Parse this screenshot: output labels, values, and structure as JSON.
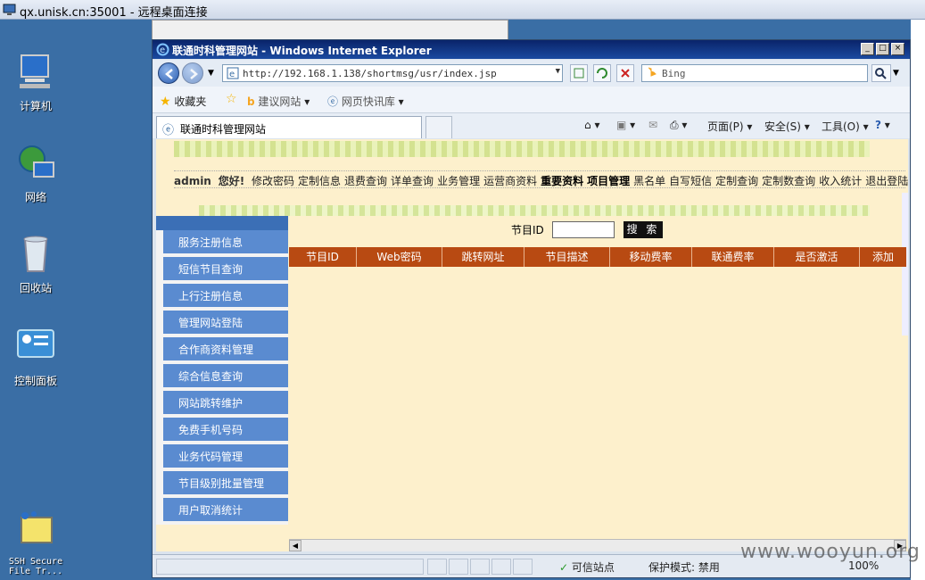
{
  "rdp": {
    "title": "qx.unisk.cn:35001 - 远程桌面连接"
  },
  "desktop": {
    "icons": [
      {
        "label": "计算机",
        "icon": "computer-icon"
      },
      {
        "label": "网络",
        "icon": "network-icon"
      },
      {
        "label": "回收站",
        "icon": "recycle-bin-icon"
      },
      {
        "label": "控制面板",
        "icon": "control-panel-icon"
      },
      {
        "label": "SSH Secure File Tr...",
        "icon": "ssh-file-transfer-icon"
      }
    ]
  },
  "ie": {
    "title": "联通时科管理网站 - Windows Internet Explorer",
    "url": "http://192.168.1.138/shortmsg/usr/index.jsp",
    "search_placeholder": "Bing",
    "favorites": {
      "label": "收藏夹",
      "suggested": "建议网站",
      "webslice": "网页快讯库"
    },
    "tab_label": "联通时科管理网站",
    "commands": {
      "page": "页面(P)",
      "safety": "安全(S)",
      "tools": "工具(O)"
    },
    "status": {
      "trusted": "可信站点",
      "protected": "保护模式: 禁用",
      "zoom": "100%"
    }
  },
  "page": {
    "greeting_user": "admin",
    "greeting_text": "您好!",
    "topnav": [
      {
        "label": "修改密码",
        "bold": false
      },
      {
        "label": "定制信息",
        "bold": false
      },
      {
        "label": "退费查询",
        "bold": false
      },
      {
        "label": "详单查询",
        "bold": false
      },
      {
        "label": "业务管理",
        "bold": false
      },
      {
        "label": "运营商资料",
        "bold": false
      },
      {
        "label": "重要资料",
        "bold": true
      },
      {
        "label": "项目管理",
        "bold": true
      },
      {
        "label": "黑名单",
        "bold": false
      },
      {
        "label": "自写短信",
        "bold": false
      },
      {
        "label": "定制查询",
        "bold": false
      },
      {
        "label": "定制数查询",
        "bold": false
      },
      {
        "label": "收入统计",
        "bold": false
      },
      {
        "label": "退出登陆",
        "bold": false
      }
    ],
    "sidebar": [
      "服务注册信息",
      "短信节目查询",
      "上行注册信息",
      "管理网站登陆",
      "合作商资料管理",
      "综合信息查询",
      "网站跳转维护",
      "免费手机号码",
      "业务代码管理",
      "节目级别批量管理",
      "用户取消统计"
    ],
    "search": {
      "label": "节目ID",
      "button": "搜 索"
    },
    "table_headers": [
      "节目ID",
      "Web密码",
      "跳转网址",
      "节目描述",
      "移动费率",
      "联通费率",
      "是否激活",
      "添加"
    ]
  },
  "watermark": "www.wooyun.org",
  "colors": {
    "sidebar": "#5a8bd0",
    "table_header": "#b84a12",
    "page_bg": "#fdf0cc",
    "desktop": "#3a6ea5"
  }
}
